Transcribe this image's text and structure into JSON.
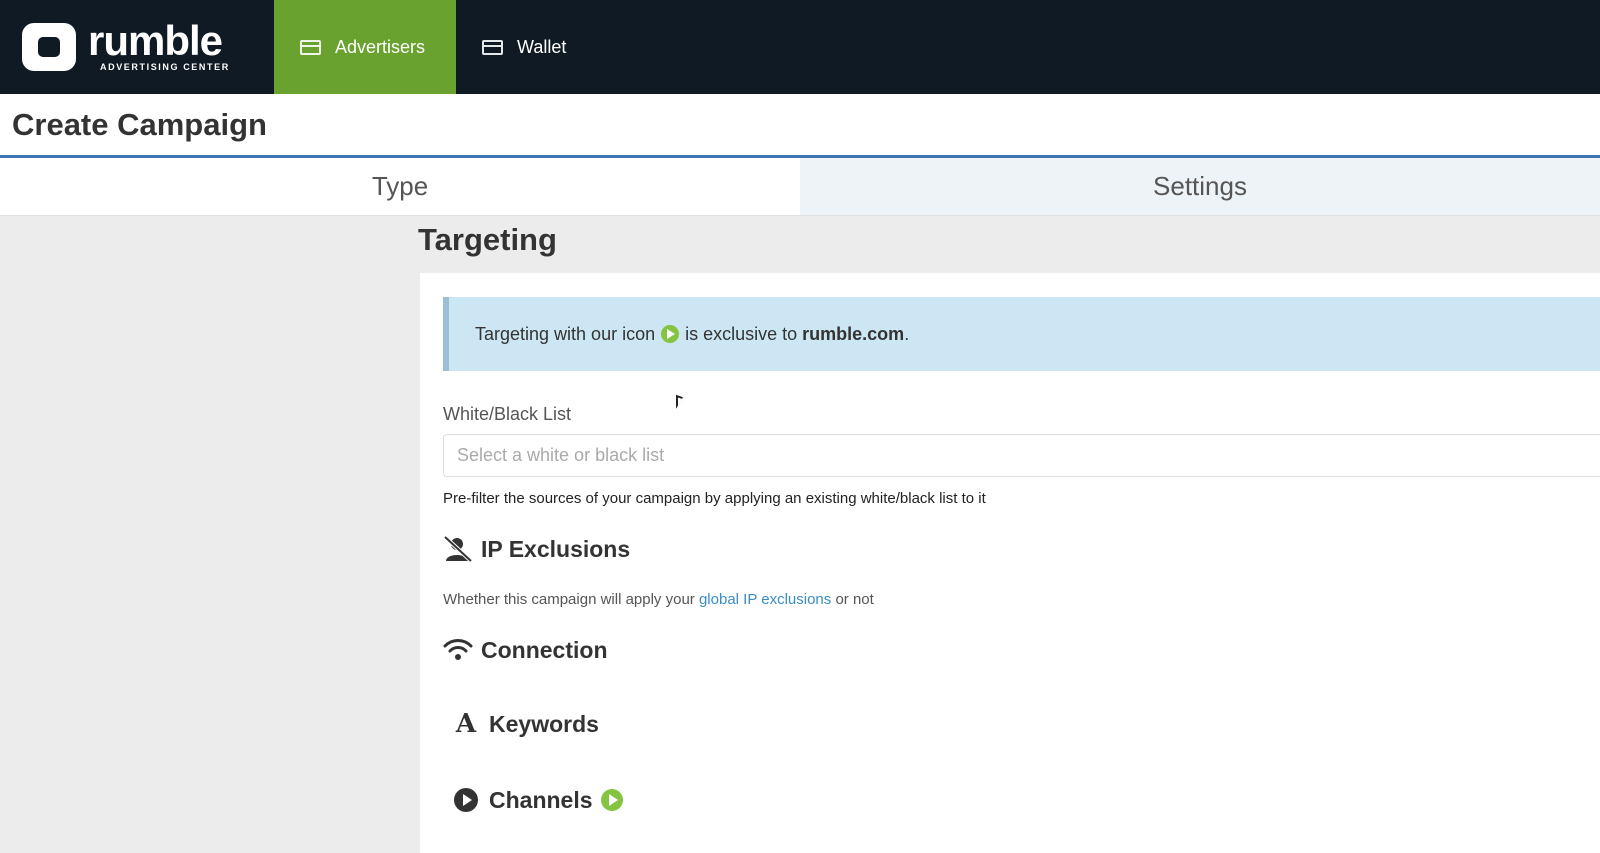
{
  "brand": {
    "name": "rumble",
    "sub": "ADVERTISING CENTER"
  },
  "nav": {
    "items": [
      {
        "label": "Advertisers",
        "icon": "card-icon"
      },
      {
        "label": "Wallet",
        "icon": "card-icon"
      }
    ],
    "active_color": "#6aa22f"
  },
  "page": {
    "title": "Create Campaign"
  },
  "steps": [
    {
      "label": "Type"
    },
    {
      "label": "Settings"
    }
  ],
  "targeting": {
    "title": "Targeting",
    "info": {
      "before": "Targeting with our icon",
      "middle": "is exclusive to",
      "brand": "rumble.com",
      "end": "."
    },
    "whitelist": {
      "label": "White/Black List",
      "placeholder": "Select a white or black list",
      "help": "Pre-filter the sources of your campaign by applying an existing white/black list to it"
    },
    "ip_exclusions": {
      "title": "IP Exclusions",
      "desc_before": "Whether this campaign will apply your",
      "link": "global IP exclusions",
      "desc_after": "or not"
    },
    "connection": {
      "title": "Connection"
    },
    "keywords": {
      "title": "Keywords",
      "icon_glyph": "A"
    },
    "channels": {
      "title": "Channels"
    }
  }
}
